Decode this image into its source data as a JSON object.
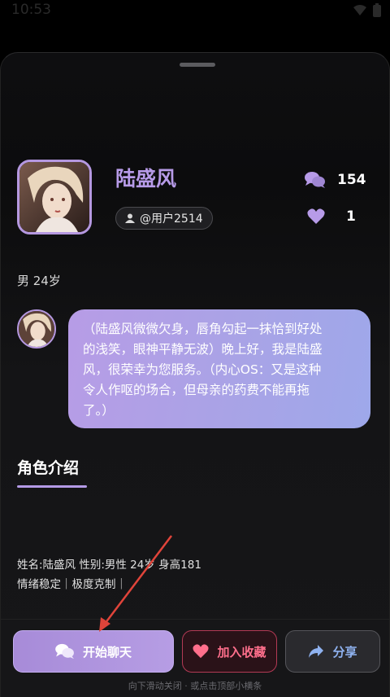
{
  "status_bar": {
    "time": "10:53"
  },
  "profile": {
    "name": "陆盛风",
    "user_id": "@用户2514",
    "stats": {
      "chats": "154",
      "likes": "1"
    },
    "gender_age": "男 24岁"
  },
  "message": {
    "text_lines": [
      "（陆盛风微微欠身，唇角勾起一抹恰到好处",
      "的浅笑，眼神平静无波）晚上好，我是陆盛",
      "风，很荣幸为您服务。（内心OS：又是这种",
      "令人作呕的场合，但母亲的药费不能再拖",
      "了。）"
    ]
  },
  "intro": {
    "title": "角色介绍",
    "line1": "姓名:陆盛风 性别:男性 24岁 身高181",
    "line2": "情绪稳定｜极度克制｜"
  },
  "actions": {
    "chat_label": "开始聊天",
    "favorite_label": "加入收藏",
    "share_label": "分享"
  },
  "hint": "向下滑动关闭 · 或点击顶部小横条",
  "colors": {
    "accent_purple": "#b79be8",
    "heart_pink": "#ff6f8c",
    "share_blue": "#8fb2f0",
    "annotation_arrow": "#e0443a"
  }
}
